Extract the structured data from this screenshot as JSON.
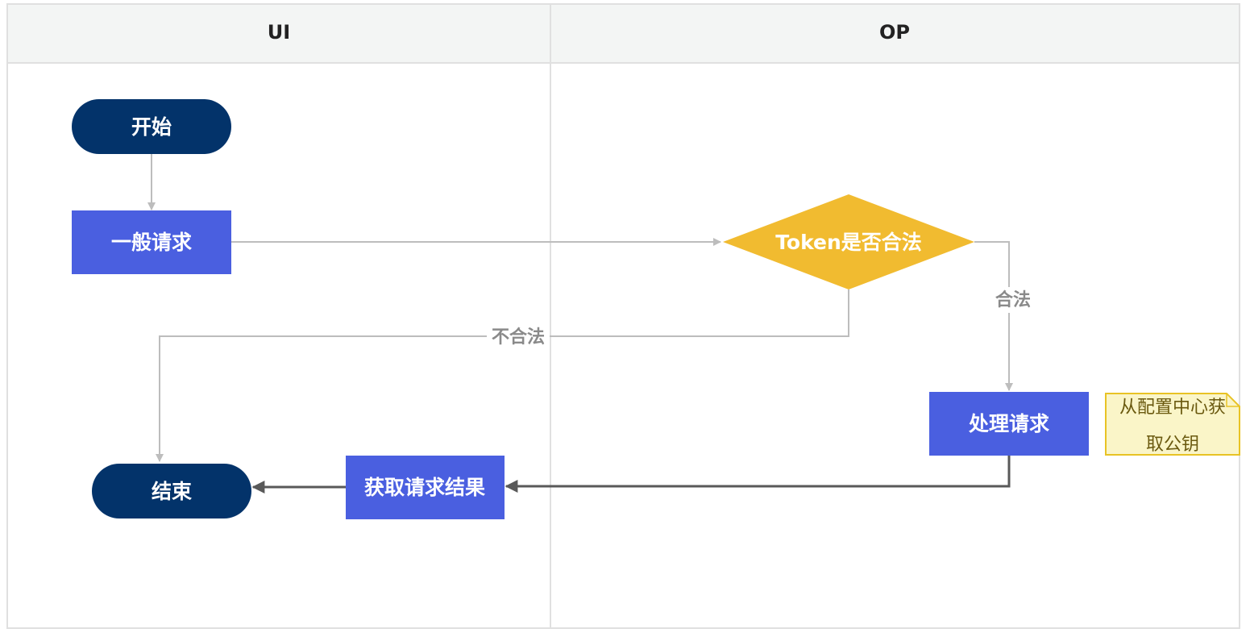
{
  "lanes": [
    {
      "title": "UI"
    },
    {
      "title": "OP"
    }
  ],
  "nodes": {
    "start": {
      "label": "开始",
      "shape": "terminator",
      "color": "#03336a"
    },
    "general_request": {
      "label": "一般请求",
      "shape": "process",
      "color": "#4a5fe0"
    },
    "token_check": {
      "label": "Token是否合法",
      "shape": "decision",
      "color": "#f1bb30"
    },
    "process_request": {
      "label": "处理请求",
      "shape": "process",
      "color": "#4a5fe0"
    },
    "get_result": {
      "label": "获取请求结果",
      "shape": "process",
      "color": "#4a5fe0"
    },
    "end": {
      "label": "结束",
      "shape": "terminator",
      "color": "#03336a"
    }
  },
  "note": {
    "line1": "从配置中心获",
    "line2": "取公钥",
    "color": "#faf5c8",
    "border_color": "#e8c325"
  },
  "edges": {
    "valid_label": "合法",
    "invalid_label": "不合法"
  },
  "colors": {
    "lane_header_bg": "#f3f5f4",
    "border": "#e0e0e0",
    "light_connector": "#bdbdbd",
    "dark_connector": "#595959"
  }
}
